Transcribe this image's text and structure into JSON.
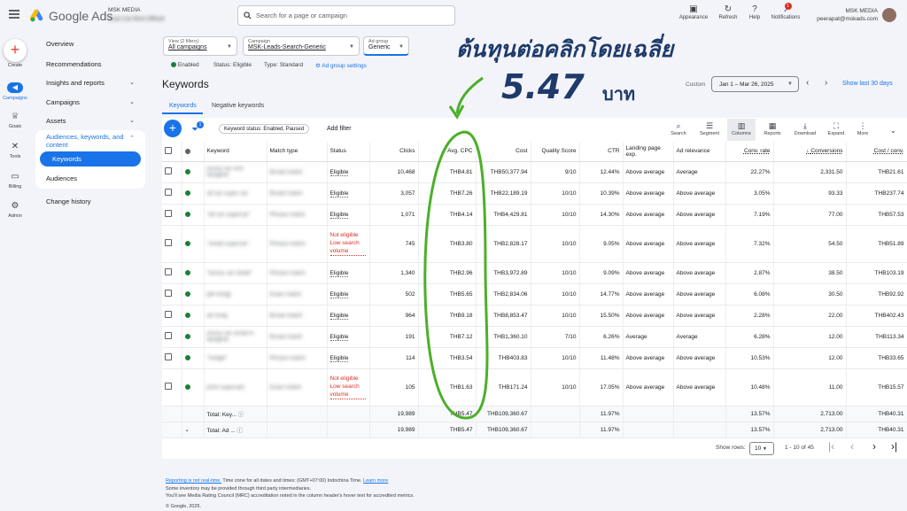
{
  "header": {
    "brand": "Google Ads",
    "account_label": "MSK MEDIA",
    "account_name": "Luxe Car Rent Official",
    "search_placeholder": "Search for a page or campaign",
    "icons": [
      {
        "name": "appearance-icon",
        "label": "Appearance"
      },
      {
        "name": "refresh-icon",
        "label": "Refresh"
      },
      {
        "name": "help-icon",
        "label": "Help"
      },
      {
        "name": "notifications-icon",
        "label": "Notifications",
        "badge": "1"
      }
    ],
    "user_org": "MSK MEDIA",
    "user_email": "peerapat@mskads.com"
  },
  "rail": {
    "create": "Create",
    "items": [
      {
        "label": "Campaigns",
        "icon": "megaphone-icon",
        "active": true
      },
      {
        "label": "Goals",
        "icon": "trophy-icon"
      },
      {
        "label": "Tools",
        "icon": "tools-icon"
      },
      {
        "label": "Billing",
        "icon": "credit-card-icon"
      },
      {
        "label": "Admin",
        "icon": "gear-icon"
      }
    ]
  },
  "nav": {
    "overview": "Overview",
    "recommendations": "Recommendations",
    "insights": "Insights and reports",
    "campaigns": "Campaigns",
    "assets": "Assets",
    "audiences": "Audiences, keywords, and content",
    "keywords": "Keywords",
    "audiences_sub": "Audiences",
    "change_history": "Change history"
  },
  "filters": {
    "view_label": "View (2 filters)",
    "view_value": "All campaigns",
    "campaign_label": "Campaign",
    "campaign_value": "MSK-Leads-Search-Generic",
    "adgroup_label": "Ad group",
    "adgroup_value": "Generic"
  },
  "status_line": {
    "enabled": "Enabled",
    "status": "Status: Eligible",
    "type": "Type: Standard",
    "settings": "Ad group settings"
  },
  "page": {
    "title": "Keywords",
    "custom_label": "Custom",
    "date_range": "Jan 1 – Mar 26, 2025",
    "show_last": "Show last 30 days",
    "tab_keywords": "Keywords",
    "tab_negative": "Negative keywords"
  },
  "toolbar": {
    "filter_badge": "1",
    "chip": "Keyword status: Enabled, Paused",
    "add_filter": "Add filter",
    "search": "Search",
    "segment": "Segment",
    "columns": "Columns",
    "reports": "Reports",
    "download": "Download",
    "expand": "Expand",
    "more": "More"
  },
  "table": {
    "headers": [
      "Keyword",
      "Match type",
      "Status",
      "Clicks",
      "Avg. CPC",
      "Cost",
      "Quality Score",
      "CTR",
      "Landing page exp.",
      "Ad relevance",
      "Conv. rate",
      "Conversions",
      "Cost / conv."
    ],
    "rows": [
      {
        "kw": "luxury car rent bangkok",
        "match": "Broad match",
        "status": "Eligible",
        "clicks": "10,468",
        "cpc": "THB4.81",
        "cost": "THB50,377.94",
        "qs": "9/10",
        "ctr": "12.44%",
        "lp": "Above average",
        "ar": "Average",
        "cr": "22.27%",
        "conv": "2,331.50",
        "cpa": "THB21.61"
      },
      {
        "kw": "all car super car",
        "match": "Broad match",
        "status": "Eligible",
        "clicks": "3,057",
        "cpc": "THB7.26",
        "cost": "THB22,189.19",
        "qs": "10/10",
        "ctr": "10.39%",
        "lp": "Above average",
        "ar": "Above average",
        "cr": "3.05%",
        "conv": "93.33",
        "cpa": "THB237.74"
      },
      {
        "kw": "\"all car supercar\"",
        "match": "Phrase match",
        "status": "Eligible",
        "clicks": "1,071",
        "cpc": "THB4.14",
        "cost": "THB4,429.81",
        "qs": "10/10",
        "ctr": "14.30%",
        "lp": "Above average",
        "ar": "Above average",
        "cr": "7.19%",
        "conv": "77.00",
        "cpa": "THB57.53"
      },
      {
        "kw": "\"rental supercar\"",
        "match": "Phrase match",
        "status": "Not eligible Low search volume",
        "clicks": "745",
        "cpc": "THB3.80",
        "cost": "THB2,828.17",
        "qs": "10/10",
        "ctr": "9.05%",
        "lp": "Above average",
        "ar": "Above average",
        "cr": "7.32%",
        "conv": "54.50",
        "cpa": "THB51.89"
      },
      {
        "kw": "\"luxury car rental\"",
        "match": "Phrase match",
        "status": "Eligible",
        "clicks": "1,340",
        "cpc": "THB2.96",
        "cost": "THB3,972.89",
        "qs": "10/10",
        "ctr": "9.09%",
        "lp": "Above average",
        "ar": "Above average",
        "cr": "2.87%",
        "conv": "38.50",
        "cpa": "THB103.19"
      },
      {
        "kw": "[all rentg]",
        "match": "Exact match",
        "status": "Eligible",
        "clicks": "502",
        "cpc": "THB5.65",
        "cost": "THB2,834.06",
        "qs": "10/10",
        "ctr": "14.77%",
        "lp": "Above average",
        "ar": "Above average",
        "cr": "6.08%",
        "conv": "30.50",
        "cpa": "THB92.92"
      },
      {
        "kw": "all rentg",
        "match": "Broad match",
        "status": "Eligible",
        "clicks": "964",
        "cpc": "THB9.18",
        "cost": "THB8,853.47",
        "qs": "10/10",
        "ctr": "15.50%",
        "lp": "Above average",
        "ar": "Above average",
        "cr": "2.28%",
        "conv": "22.00",
        "cpa": "THB402.43"
      },
      {
        "kw": "luxury car rental in bangkok",
        "match": "Broad match",
        "status": "Eligible",
        "clicks": "191",
        "cpc": "THB7.12",
        "cost": "THB1,360.10",
        "qs": "7/10",
        "ctr": "6.26%",
        "lp": "Average",
        "ar": "Average",
        "cr": "6.28%",
        "conv": "12.00",
        "cpa": "THB113.34"
      },
      {
        "kw": "\"rentgh\"",
        "match": "Phrase match",
        "status": "Eligible",
        "clicks": "114",
        "cpc": "THB3.54",
        "cost": "THB403.83",
        "qs": "10/10",
        "ctr": "11.48%",
        "lp": "Above average",
        "ar": "Above average",
        "cr": "10.53%",
        "conv": "12.00",
        "cpa": "THB33.65"
      },
      {
        "kw": "[rent supercar]",
        "match": "Exact match",
        "status": "Not eligible Low search volume",
        "clicks": "105",
        "cpc": "THB1.63",
        "cost": "THB171.24",
        "qs": "10/10",
        "ctr": "17.05%",
        "lp": "Above average",
        "ar": "Above average",
        "cr": "10.48%",
        "conv": "11.00",
        "cpa": "THB15.57"
      }
    ],
    "total1": {
      "label": "Total: Key...",
      "clicks": "19,989",
      "cpc": "THB5.47",
      "cost": "THB109,360.67",
      "ctr": "11.97%",
      "cr": "13.57%",
      "conv": "2,713.00",
      "cpa": "THB40.31"
    },
    "total2": {
      "label": "Total: Ad ...",
      "clicks": "19,989",
      "cpc": "THB5.47",
      "cost": "THB109,360.67",
      "ctr": "11.97%",
      "cr": "13.57%",
      "conv": "2,713.00",
      "cpa": "THB40.31"
    }
  },
  "pager": {
    "show_rows_label": "Show rows:",
    "rows": "10",
    "range": "1 - 10 of 45"
  },
  "footer": {
    "link": "Reporting is not real-time.",
    "tz": "Time zone for all dates and times: (GMT+07:00) Indochina Time.",
    "learn": "Learn more",
    "line2": "Some inventory may be provided through third party intermediaries.",
    "line3": "You'll see Media Rating Council (MRC) accreditation noted in the column header's hover text for accredited metrics.",
    "copyright": "© Google, 2025."
  },
  "overlay": {
    "line1": "ต้นทุนต่อคลิกโดยเฉลี่ย",
    "value": "5.47",
    "unit": "บาท",
    "color": "#4caf2a"
  }
}
